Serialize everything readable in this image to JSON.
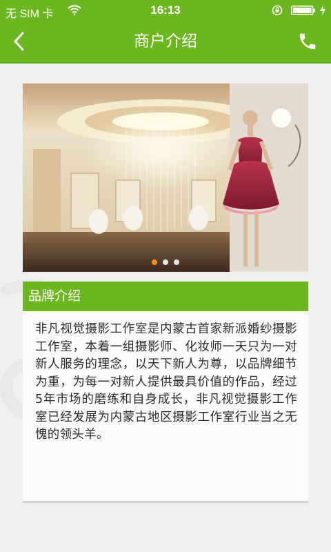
{
  "status_bar": {
    "carrier": "无 SIM 卡",
    "time": "16:13",
    "icons": [
      "wifi-icon",
      "rotation-lock-icon",
      "battery-icon",
      "charging-icon"
    ]
  },
  "nav": {
    "title": "商户介绍",
    "back_icon": "chevron-left-icon",
    "call_icon": "phone-icon"
  },
  "banner": {
    "slide_count": 3,
    "active_index": 0
  },
  "brand": {
    "heading": "品牌介绍",
    "body": "非凡视觉摄影工作室是内蒙古首家新派婚纱摄影工作室，本着一组摄影师、化妆师一天只为一对新人服务的理念，以天下新人为尊，以品牌细节为重，为每一对新人提供最具价值的作品，经过5年市场的磨练和自身成长，非凡视觉摄影工作室已经发展为内蒙古地区摄影工作室行业当之无愧的领头羊。"
  },
  "colors": {
    "brand_green": "#6cb71f",
    "background": "#efefef",
    "dot_active": "#f08d1e",
    "dot_inactive": "#e6e6e6"
  }
}
